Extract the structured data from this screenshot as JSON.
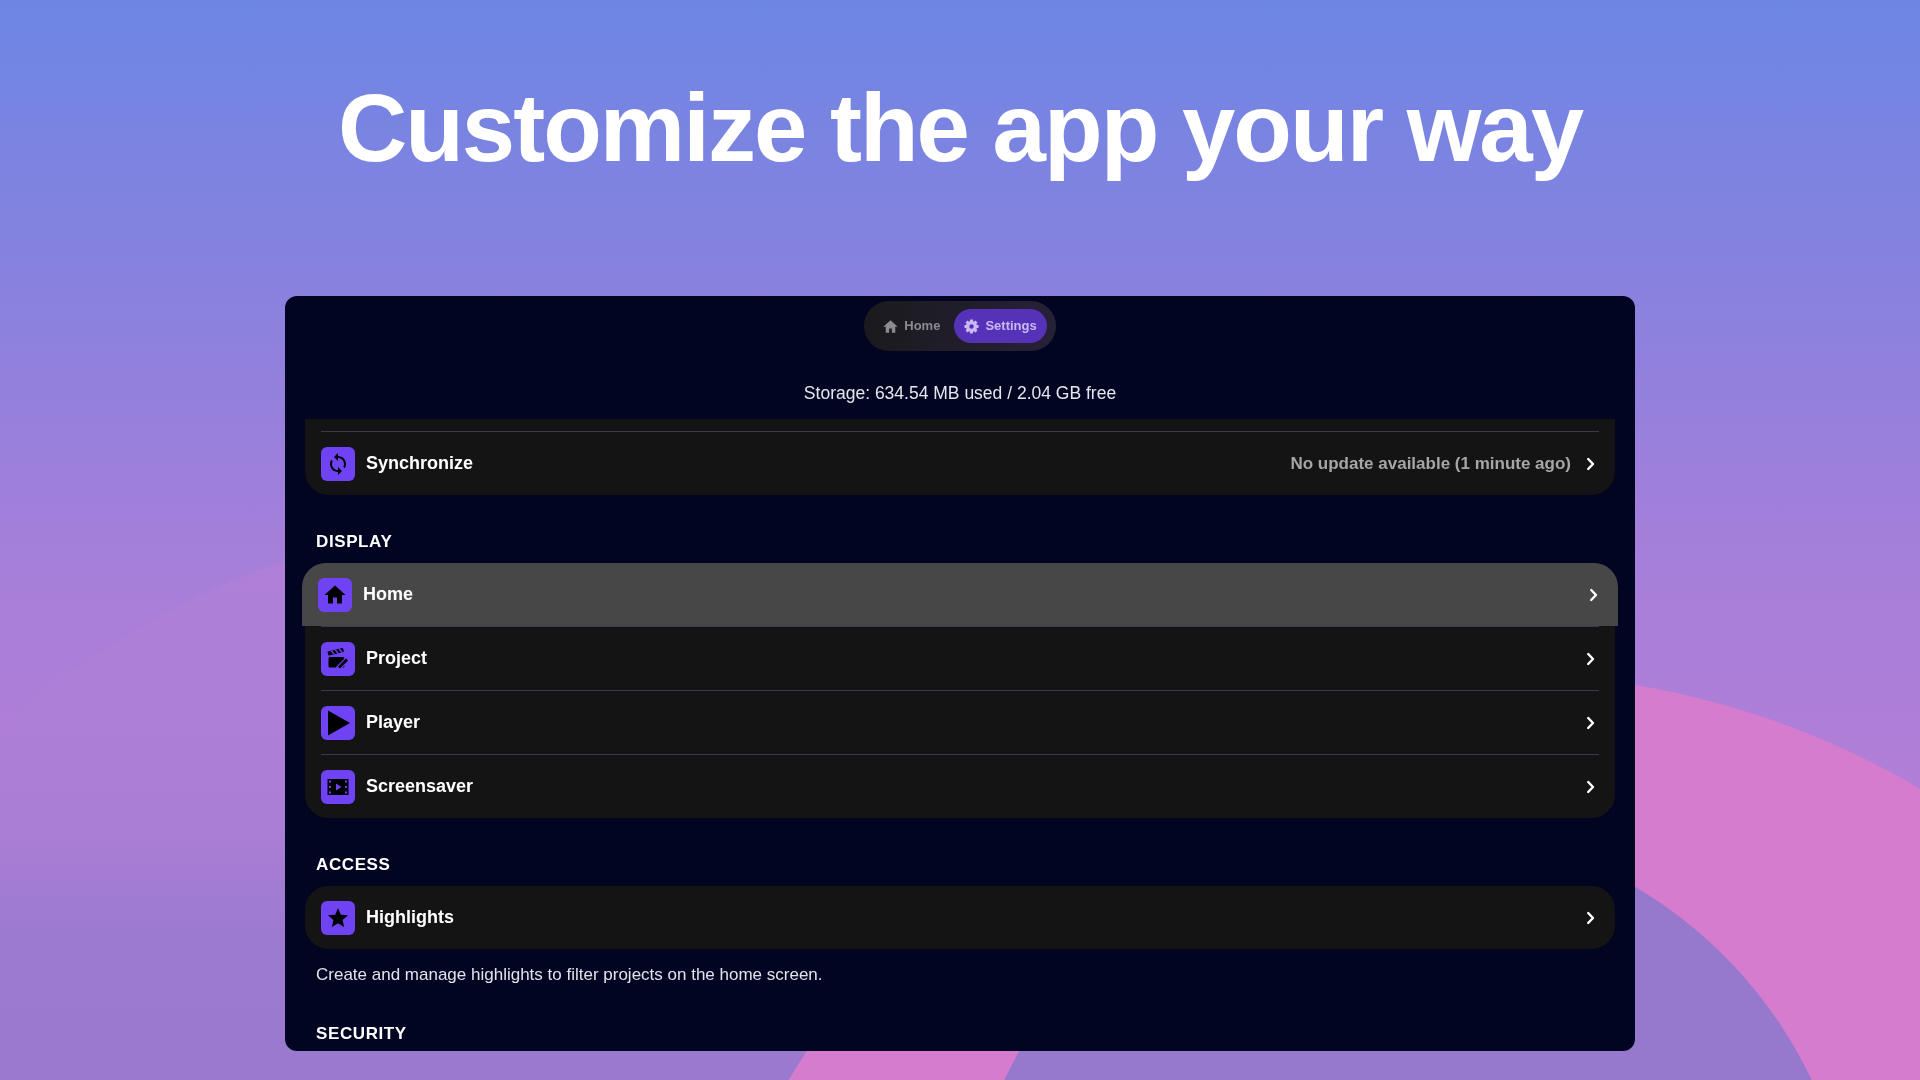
{
  "headline": "Customize the app your way",
  "tabs": [
    {
      "label": "Home",
      "selected": false
    },
    {
      "label": "Settings",
      "selected": true
    }
  ],
  "storage": "Storage: 634.54 MB used / 2.04 GB free",
  "sections": [
    {
      "items": [
        {
          "label": "Synchronize",
          "value": "No update available (1 minute ago)",
          "selected": false
        }
      ]
    },
    {
      "heading": "DISPLAY",
      "items": [
        {
          "label": "Home",
          "selected": true
        },
        {
          "label": "Project",
          "selected": false
        },
        {
          "label": "Player",
          "selected": false
        },
        {
          "label": "Screensaver",
          "selected": false
        }
      ]
    },
    {
      "heading": "ACCESS",
      "items": [
        {
          "label": "Highlights",
          "selected": false
        }
      ],
      "description": "Create and manage highlights to filter projects on the home screen."
    },
    {
      "heading": "SECURITY"
    }
  ]
}
